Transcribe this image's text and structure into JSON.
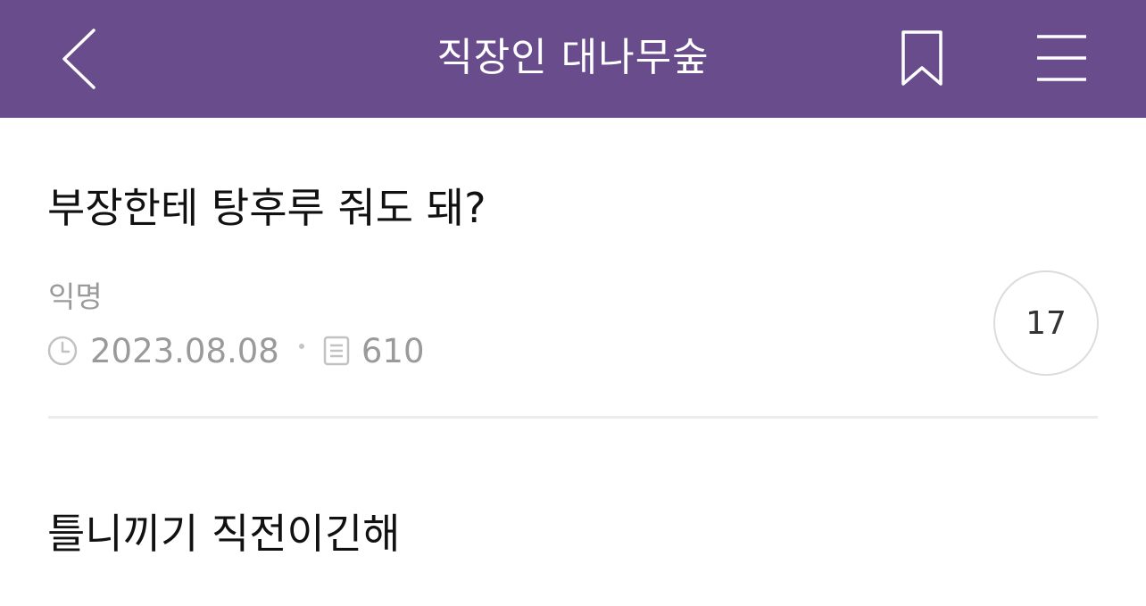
{
  "header": {
    "title": "직장인 대나무숲",
    "back_icon": "chevron-left-icon",
    "bookmark_icon": "bookmark-icon",
    "menu_icon": "hamburger-menu-icon",
    "background_color": "#684c8c"
  },
  "post": {
    "title": "부장한테 탕후루 줘도 돼?",
    "author": "익명",
    "date": "2023.08.08",
    "views": "610",
    "comment_count": "17",
    "body": "틀니끼기 직전이긴해"
  }
}
